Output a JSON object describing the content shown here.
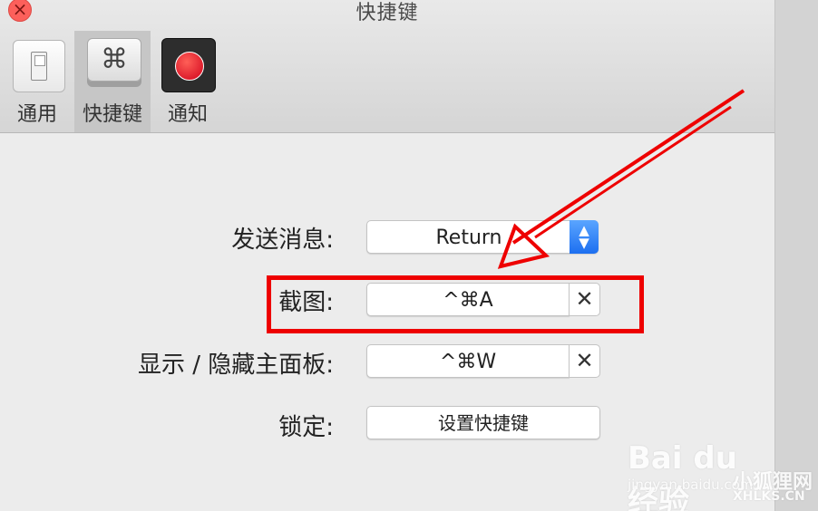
{
  "window": {
    "title": "快捷键"
  },
  "toolbar": {
    "items": [
      {
        "label": "通用"
      },
      {
        "label": "快捷键",
        "symbol": "⌘"
      },
      {
        "label": "通知"
      }
    ]
  },
  "settings": {
    "send": {
      "label": "发送消息:",
      "value": "Return"
    },
    "screenshot": {
      "label": "截图:",
      "value": "^⌘A"
    },
    "toggle_panel": {
      "label": "显示 / 隐藏主面板:",
      "value": "^⌘W"
    },
    "lock": {
      "label": "锁定:",
      "button": "设置快捷键"
    }
  },
  "clear_symbol": "✕",
  "watermark": {
    "brand": "Bai du 经验",
    "url": "jingyan.baidu.com",
    "site_name": "小狐狸网",
    "site_url": "XHLKS.CN"
  },
  "colors": {
    "highlight": "#ee0000",
    "accent": "#1d6ff0",
    "close": "#fc605b"
  }
}
